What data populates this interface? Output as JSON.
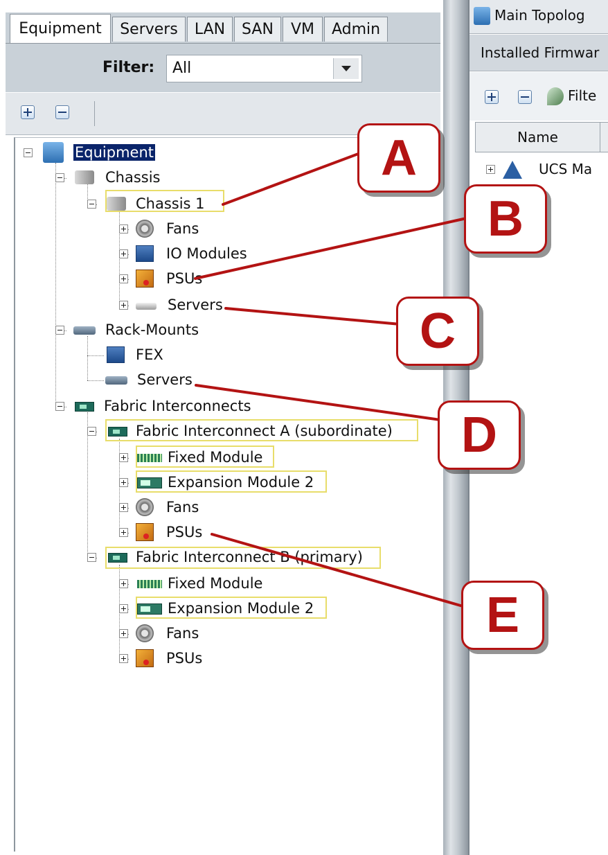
{
  "left_tabs": [
    "Equipment",
    "Servers",
    "LAN",
    "SAN",
    "VM",
    "Admin"
  ],
  "filter": {
    "label": "Filter:",
    "value": "All"
  },
  "tree": {
    "root": "Equipment",
    "chassis": "Chassis",
    "chassis1": "Chassis 1",
    "fans": "Fans",
    "io_modules": "IO Modules",
    "psus": "PSUs",
    "servers": "Servers",
    "rack_mounts": "Rack-Mounts",
    "fex": "FEX",
    "rack_servers": "Servers",
    "fabric_interconnects": "Fabric Interconnects",
    "fi_a": "Fabric Interconnect A (subordinate)",
    "fi_a_fixed": "Fixed Module",
    "fi_a_exp": "Expansion Module 2",
    "fi_a_fans": "Fans",
    "fi_a_psus": "PSUs",
    "fi_b": "Fabric Interconnect B (primary)",
    "fi_b_fixed": "Fixed Module",
    "fi_b_exp": "Expansion Module 2",
    "fi_b_fans": "Fans",
    "fi_b_psus": "PSUs"
  },
  "right": {
    "title": "Main Topolog",
    "subtab": "Installed Firmwar",
    "filter_btn": "Filte",
    "column": "Name",
    "row": "UCS Ma"
  },
  "callouts": [
    "A",
    "B",
    "C",
    "D",
    "E"
  ],
  "colors": {
    "callout": "#b31313",
    "highlight": "#e8dd6a",
    "selection": "#0a246a"
  }
}
